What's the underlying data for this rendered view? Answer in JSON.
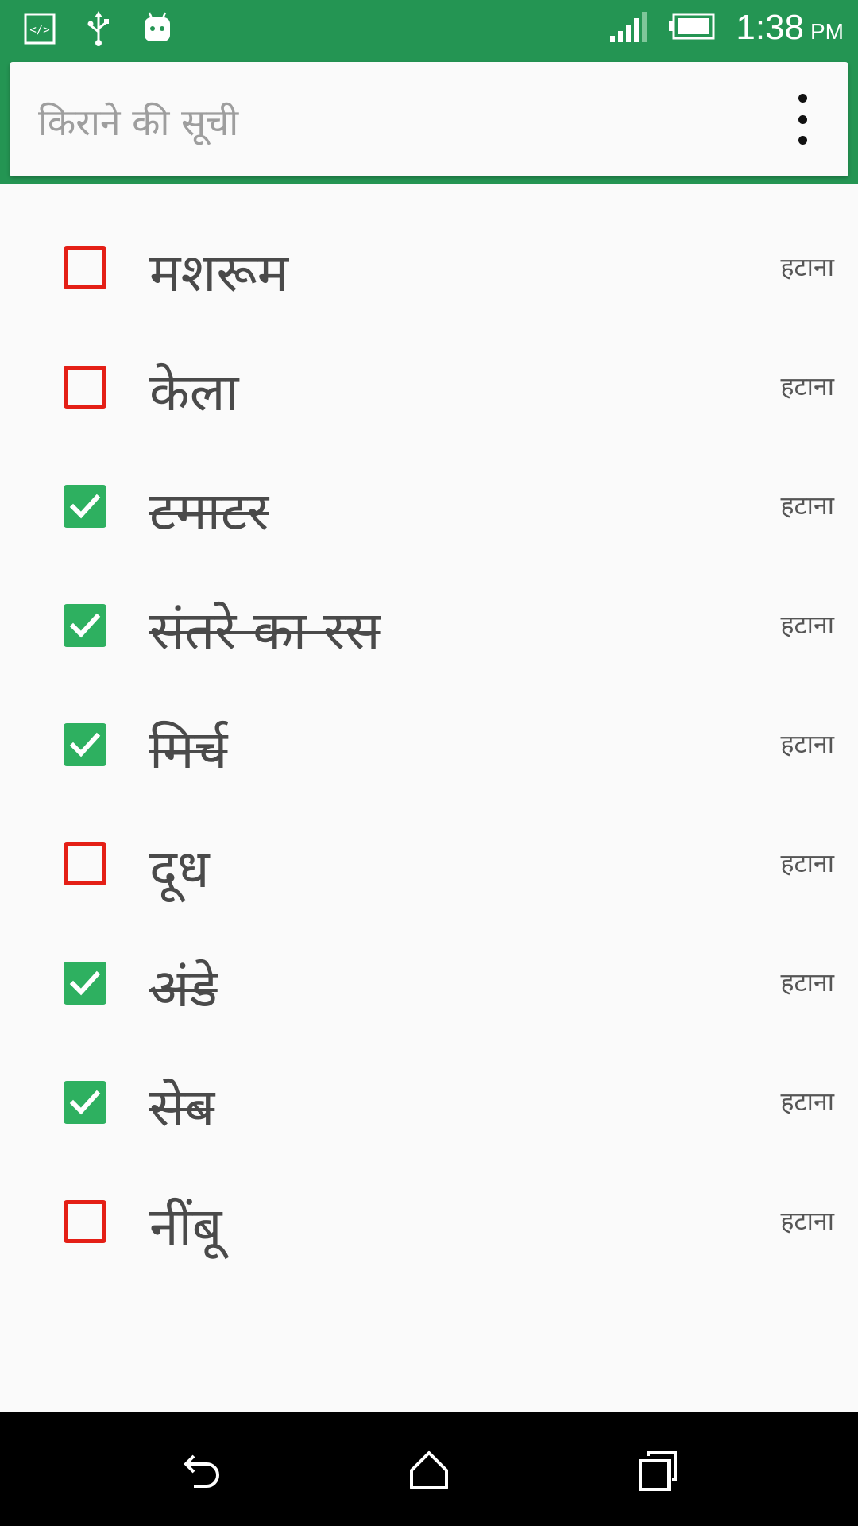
{
  "status_bar": {
    "time": "1:38",
    "ampm": "PM",
    "icons": [
      "code-icon",
      "usb-icon",
      "android-icon",
      "signal-icon",
      "battery-icon"
    ]
  },
  "app_bar": {
    "search_placeholder": "किराने की सूची",
    "menu_icon": "more-vert-icon"
  },
  "colors": {
    "primary": "#249553",
    "checked": "#2eb060",
    "unchecked_border": "#e41f16"
  },
  "items": [
    {
      "label": "मशरूम",
      "checked": false,
      "remove_label": "हटाना"
    },
    {
      "label": "केला",
      "checked": false,
      "remove_label": "हटाना"
    },
    {
      "label": "टमाटर",
      "checked": true,
      "remove_label": "हटाना"
    },
    {
      "label": "संतरे का रस",
      "checked": true,
      "remove_label": "हटाना"
    },
    {
      "label": "मिर्च",
      "checked": true,
      "remove_label": "हटाना"
    },
    {
      "label": "दूध",
      "checked": false,
      "remove_label": "हटाना"
    },
    {
      "label": "अंडे",
      "checked": true,
      "remove_label": "हटाना"
    },
    {
      "label": "सेब",
      "checked": true,
      "remove_label": "हटाना"
    },
    {
      "label": "नींबू",
      "checked": false,
      "remove_label": "हटाना"
    }
  ],
  "nav_bar": {
    "buttons": [
      "back-icon",
      "home-icon",
      "recents-icon"
    ]
  }
}
